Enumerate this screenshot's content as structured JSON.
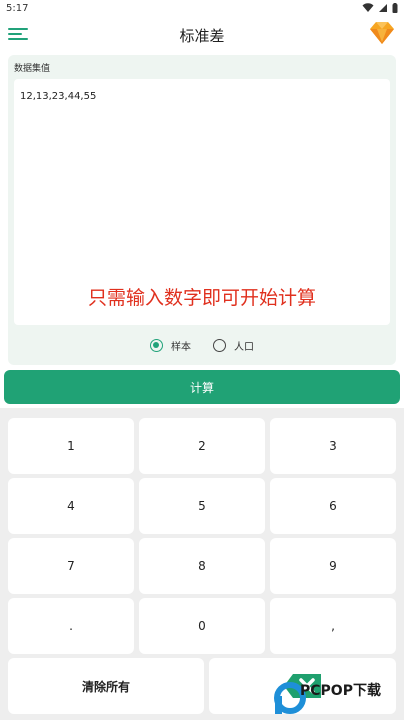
{
  "status_bar": {
    "time": "5:17"
  },
  "app_bar": {
    "title": "标准差"
  },
  "panel": {
    "label": "数据集值",
    "input_value": "12,13,23,44,55",
    "caption": "只需输入数字即可开始计算"
  },
  "radios": {
    "sample_label": "样本",
    "population_label": "人口",
    "selected": "样本"
  },
  "calculate_label": "计算",
  "keypad": {
    "row1": [
      "1",
      "2",
      "3"
    ],
    "row2": [
      "4",
      "5",
      "6"
    ],
    "row3": [
      "7",
      "8",
      "9"
    ],
    "row4": [
      ".",
      "0",
      ","
    ],
    "clear_all_label": "清除所有"
  },
  "watermark": {
    "text": "PCPOP下载"
  },
  "colors": {
    "accent": "#20a275",
    "caption": "#e0301e",
    "panel_bg": "#eef5f1"
  }
}
